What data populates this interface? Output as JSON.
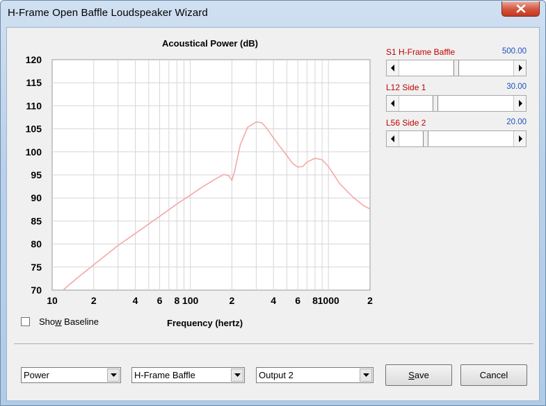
{
  "window": {
    "title": "H-Frame Open Baffle Loudspeaker Wizard"
  },
  "sliders": [
    {
      "label": "S1  H-Frame Baffle",
      "value": "500.00",
      "position": 0.5
    },
    {
      "label": "L12  Side 1",
      "value": "30.00",
      "position": 0.27
    },
    {
      "label": "L56  Side 2",
      "value": "20.00",
      "position": 0.21
    }
  ],
  "checkbox": {
    "label_pre": "Sho",
    "label_accel": "w",
    "label_post": " Baseline",
    "checked": false
  },
  "combos": [
    {
      "value": "Power"
    },
    {
      "value": "H-Frame Baffle"
    },
    {
      "value": "Output 2"
    }
  ],
  "buttons": {
    "save_accel": "S",
    "save_rest": "ave",
    "cancel": "Cancel"
  },
  "colors": {
    "curve": "#f4a8a8",
    "slider_label": "#c00000",
    "slider_value": "#1f4fc0"
  },
  "chart_data": {
    "type": "line",
    "title": "Acoustical Power (dB)",
    "xlabel": "Frequency (hertz)",
    "ylabel": "",
    "xscale": "log",
    "xlim": [
      10,
      2000
    ],
    "ylim": [
      70,
      120
    ],
    "yticks": [
      "120",
      "115",
      "110",
      "105",
      "100",
      "95",
      "90",
      "85",
      "80",
      "75",
      "70"
    ],
    "xtick_labels": [
      {
        "x": 10,
        "label": "10"
      },
      {
        "x": 20,
        "label": "2"
      },
      {
        "x": 40,
        "label": "4"
      },
      {
        "x": 60,
        "label": "6"
      },
      {
        "x": 80,
        "label": "8"
      },
      {
        "x": 100,
        "label": "100"
      },
      {
        "x": 200,
        "label": "2"
      },
      {
        "x": 400,
        "label": "4"
      },
      {
        "x": 600,
        "label": "6"
      },
      {
        "x": 800,
        "label": "8"
      },
      {
        "x": 1000,
        "label": "1000"
      },
      {
        "x": 2000,
        "label": "2"
      }
    ],
    "grid": true,
    "series": [
      {
        "x": [
          12,
          15,
          20,
          30,
          40,
          60,
          80,
          100,
          120,
          150,
          175,
          190,
          200,
          210,
          230,
          260,
          300,
          330,
          360,
          400,
          450,
          500,
          550,
          600,
          650,
          700,
          800,
          900,
          1000,
          1200,
          1500,
          1800,
          2000
        ],
        "y": [
          70,
          72.5,
          75.5,
          79.7,
          82.3,
          86.0,
          88.7,
          90.6,
          92.2,
          94.0,
          95.1,
          94.8,
          93.8,
          96.0,
          101.5,
          105.3,
          106.5,
          106.3,
          105.0,
          103.0,
          101.0,
          99.2,
          97.5,
          96.7,
          96.8,
          97.8,
          98.6,
          98.3,
          96.8,
          93.2,
          90.2,
          88.3,
          87.6
        ]
      }
    ]
  }
}
